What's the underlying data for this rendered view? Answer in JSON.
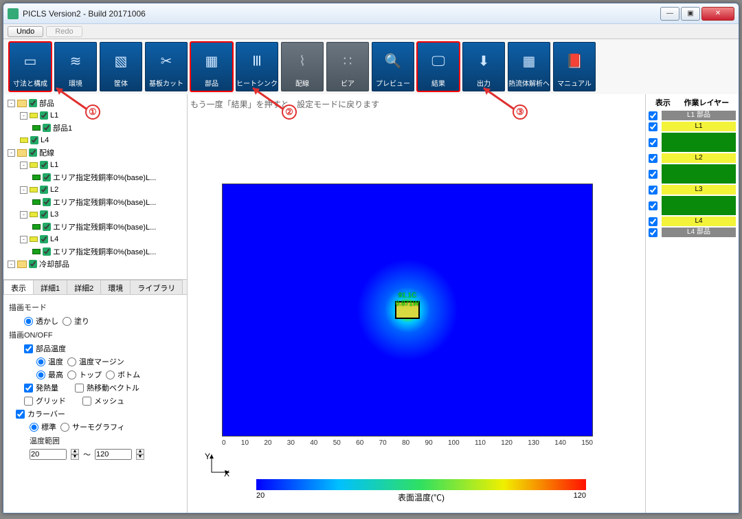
{
  "window": {
    "title": "PICLS Version2 - Build 20171006"
  },
  "undo": "Undo",
  "redo": "Redo",
  "hint": "もう一度「結果」を押すと、設定モードに戻ります",
  "tools": [
    {
      "label": "寸法と構成",
      "hl": true
    },
    {
      "label": "環境"
    },
    {
      "label": "筐体"
    },
    {
      "label": "基板カット"
    },
    {
      "label": "部品",
      "hl": true
    },
    {
      "label": "ヒートシンク"
    },
    {
      "label": "配線",
      "dim": true
    },
    {
      "label": "ビア",
      "dim": true
    },
    {
      "label": "プレビュー"
    },
    {
      "label": "結果",
      "hl": true
    },
    {
      "label": "出力"
    },
    {
      "label": "熱流体解析へ"
    },
    {
      "label": "マニュアル"
    }
  ],
  "tree": [
    {
      "d": 0,
      "exp": "-",
      "fld": true,
      "chk": true,
      "txt": "部品"
    },
    {
      "d": 1,
      "exp": "-",
      "leaf": "y",
      "chk": true,
      "txt": "L1"
    },
    {
      "d": 2,
      "leaf": "g",
      "chk": true,
      "txt": "部品1"
    },
    {
      "d": 1,
      "leaf": "y",
      "chk": true,
      "txt": "L4"
    },
    {
      "d": 0,
      "exp": "-",
      "fld": true,
      "chk": true,
      "txt": "配線"
    },
    {
      "d": 1,
      "exp": "-",
      "leaf": "y",
      "chk": true,
      "txt": "L1"
    },
    {
      "d": 2,
      "leaf": "g",
      "chk": true,
      "txt": "エリア指定残銅率0%(base)L..."
    },
    {
      "d": 1,
      "exp": "-",
      "leaf": "y",
      "chk": true,
      "txt": "L2"
    },
    {
      "d": 2,
      "leaf": "g",
      "chk": true,
      "txt": "エリア指定残銅率0%(base)L..."
    },
    {
      "d": 1,
      "exp": "-",
      "leaf": "y",
      "chk": true,
      "txt": "L3"
    },
    {
      "d": 2,
      "leaf": "g",
      "chk": true,
      "txt": "エリア指定残銅率0%(base)L..."
    },
    {
      "d": 1,
      "exp": "-",
      "leaf": "y",
      "chk": true,
      "txt": "L4"
    },
    {
      "d": 2,
      "leaf": "g",
      "chk": true,
      "txt": "エリア指定残銅率0%(base)L..."
    },
    {
      "d": 0,
      "exp": "-",
      "fld": true,
      "chk": true,
      "txt": "冷却部品"
    }
  ],
  "tabs": [
    "表示",
    "詳細1",
    "詳細2",
    "環境",
    "ライブラリ"
  ],
  "panel": {
    "drawmode": "描画モード",
    "transparent": "透かし",
    "fill": "塗り",
    "onoff": "描画ON/OFF",
    "parttemp": "部品温度",
    "temp": "温度",
    "margin": "温度マージン",
    "max": "最高",
    "top": "トップ",
    "bottom": "ボトム",
    "heat": "発熱量",
    "vector": "熱移動ベクトル",
    "grid": "グリッド",
    "mesh": "メッシュ",
    "colorbar": "カラーバー",
    "standard": "標準",
    "thermo": "サーモグラフィ",
    "range": "温度範囲",
    "lo": "20",
    "hi": "120",
    "sep": "～"
  },
  "right": {
    "show": "表示",
    "work": "作業レイヤー",
    "layers": [
      "L1 部品",
      "L1",
      "L2",
      "L3",
      "L4",
      "L4 部品"
    ]
  },
  "comp": {
    "t": "91.1C",
    "w": "0.871W"
  },
  "colorbar": {
    "lo": "20",
    "hi": "120",
    "label": "表面温度(℃)"
  },
  "axes": {
    "y": "Y",
    "x": "X"
  },
  "xaxis": [
    "0",
    "10",
    "20",
    "30",
    "40",
    "50",
    "60",
    "70",
    "80",
    "90",
    "100",
    "110",
    "120",
    "130",
    "140",
    "150"
  ],
  "anno": {
    "a1": "①",
    "a2": "②",
    "a3": "③"
  }
}
